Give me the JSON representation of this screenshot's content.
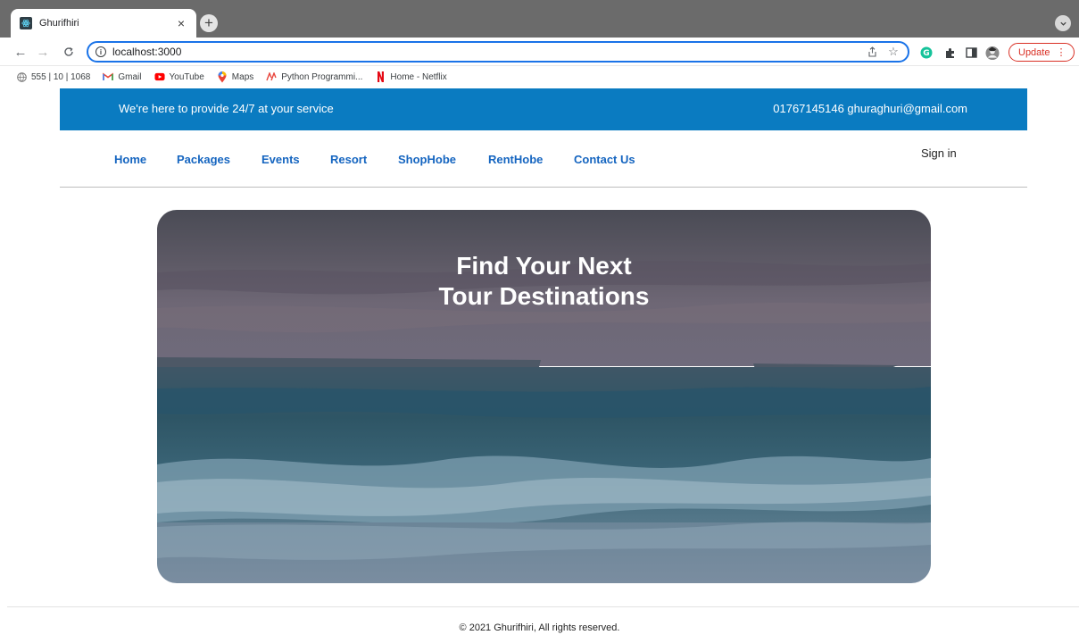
{
  "browser": {
    "tab_title": "Ghurifhiri",
    "tab_close": "×",
    "new_tab": "+",
    "url": "localhost:3000",
    "update_label": "Update",
    "update_dots": "⋮",
    "bookmarks": [
      {
        "label": "555 | 10 | 1068",
        "icon": "globe-icon"
      },
      {
        "label": "Gmail",
        "icon": "gmail-icon"
      },
      {
        "label": "YouTube",
        "icon": "youtube-icon"
      },
      {
        "label": "Maps",
        "icon": "maps-icon"
      },
      {
        "label": "Python Programmi...",
        "icon": "python-icon"
      },
      {
        "label": "Home - Netflix",
        "icon": "netflix-icon"
      }
    ]
  },
  "topbar": {
    "tagline": "We're here to provide 24/7 at your service",
    "contact": "01767145146 ghuraghuri@gmail.com"
  },
  "nav": {
    "links": [
      "Home",
      "Packages",
      "Events",
      "Resort",
      "ShopHobe",
      "RentHobe",
      "Contact Us"
    ],
    "signin": "Sign in"
  },
  "hero": {
    "title_line1": "Find Your Next",
    "title_line2": "Tour Destinations"
  },
  "footer": {
    "copyright": "© 2021 Ghurifhiri, All rights reserved."
  },
  "colors": {
    "topbar_bg": "#0a7bc1",
    "nav_link": "#1565c0",
    "omnibox_border": "#1a73e8",
    "update_red": "#d93025"
  }
}
